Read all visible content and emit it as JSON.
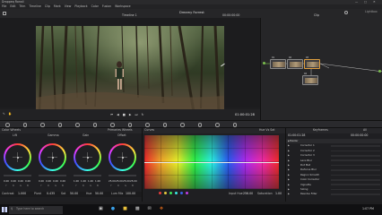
{
  "titlebar": {
    "app_title": "Drappeq Ronali"
  },
  "menu": {
    "items": [
      "File",
      "Edit",
      "Trim",
      "Timeline",
      "Clip",
      "Mark",
      "View",
      "Playback",
      "Color",
      "Fusion",
      "Workspace"
    ]
  },
  "viewer_header": {
    "timeline_name": "Timeline 1",
    "project_title": "Dreamy Forrest",
    "timecode": "00:00:00:00",
    "clip_label": "Clip",
    "zoom_label": "Lightbox"
  },
  "transport": {
    "timecode": "01:00:01:28"
  },
  "panels": {
    "color_wheels": "Color Wheels",
    "primaries_wheels": "Primaries Wheels",
    "curves": "Curves",
    "hue_vs_sat": "Hue Vs Sat",
    "keyframes": "Keyframes",
    "all": "All"
  },
  "wheels": [
    {
      "label": "Lift",
      "values": [
        "0.00",
        "0.00",
        "0.00",
        "0.00"
      ]
    },
    {
      "label": "Gamma",
      "values": [
        "0.00",
        "0.00",
        "0.00",
        "0.00"
      ]
    },
    {
      "label": "Gain",
      "values": [
        "1.00",
        "1.00",
        "1.00",
        "1.00"
      ]
    },
    {
      "label": "Offset",
      "values": [
        "25.00",
        "25.00",
        "25.00",
        "25.00"
      ]
    }
  ],
  "wheel_channels": [
    "Y",
    "R",
    "G",
    "B"
  ],
  "wheel_footer": {
    "contrast_label": "Contrast",
    "contrast_value": "1.000",
    "pivot_label": "Pivot",
    "pivot_value": "0.435",
    "sat_label": "Sat",
    "sat_value": "50.00",
    "hue_label": "Hue",
    "hue_value": "50.00",
    "lummix_label": "Lum Mix",
    "lummix_value": "100.00"
  },
  "curves_footer": {
    "input_hue_label": "Input Hue",
    "input_hue_value": "256.00",
    "saturation_label": "Saturation",
    "saturation_value": "1.00"
  },
  "keyframes_header": {
    "timecode_a": "01:00:01:28",
    "timecode_b": "00:00:00:00"
  },
  "keyframe_rows": [
    "Master",
    "Corrector 1",
    "Corrector 2",
    "Corrector 3",
    "Lens Blur",
    "Dot Mat",
    "Defocus Blur",
    "Region Smooth",
    "Color Corrector",
    "Vignette",
    "Sizing",
    "Resolve Filter"
  ],
  "nodes": [
    {
      "label": "01"
    },
    {
      "label": "02"
    },
    {
      "label": "03"
    },
    {
      "label": "04"
    },
    {
      "label": "05"
    }
  ],
  "taskbar": {
    "search_placeholder": "Type here to search",
    "time": "1:07 PM"
  },
  "colors": {
    "accent": "#e06a1a",
    "panel": "#1f1f22",
    "header": "#2b2b2e"
  }
}
